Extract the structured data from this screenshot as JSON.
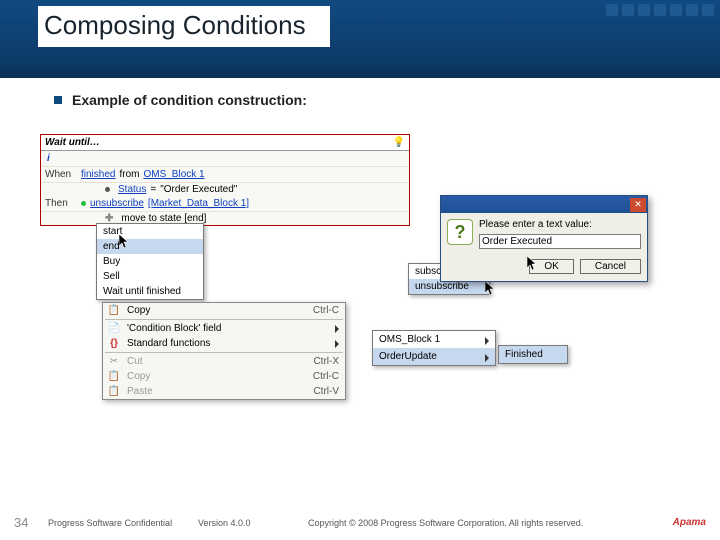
{
  "header": {
    "title": "Composing Conditions"
  },
  "bullet": {
    "text": "Example of condition construction:"
  },
  "wait_block": {
    "title": "Wait until…",
    "when_label": "When",
    "when_value_a": "finished",
    "when_value_b": "from",
    "when_value_c": "OMS_Block 1",
    "cond_status_lhs": "Status",
    "cond_status_op": "=",
    "cond_status_rhs": "\"Order Executed\"",
    "then_label": "Then",
    "action1_a": "unsubscribe",
    "action1_b": "[Market_Data_Block 1]",
    "action2": "move to state [end]"
  },
  "menu1": {
    "items": [
      "start",
      "end",
      "Buy",
      "Sell",
      "Wait until finished"
    ]
  },
  "menu2": {
    "items": [
      "subscribe",
      "unsubscribe"
    ]
  },
  "menu3": {
    "items": [
      {
        "label": "Copy",
        "shortcut": "Ctrl-C"
      },
      {
        "label": "'Condition Block' field"
      },
      {
        "label": "Standard functions"
      },
      {
        "label": "Cut",
        "shortcut": "Ctrl-X",
        "dim": true
      },
      {
        "label": "Copy",
        "shortcut": "Ctrl-C",
        "dim": true
      },
      {
        "label": "Paste",
        "shortcut": "Ctrl-V",
        "dim": true
      }
    ]
  },
  "menu4": {
    "items": [
      "OMS_Block 1",
      "OrderUpdate"
    ]
  },
  "menu5": {
    "items": [
      "Finished"
    ]
  },
  "dialog": {
    "prompt": "Please enter a text value:",
    "value": "Order Executed",
    "ok": "OK",
    "cancel": "Cancel"
  },
  "footer": {
    "page": "34",
    "confidential": "Progress Software Confidential",
    "version": "Version 4.0.0",
    "copyright": "Copyright © 2008 Progress Software Corporation. All rights reserved.",
    "logo": "Apama"
  }
}
